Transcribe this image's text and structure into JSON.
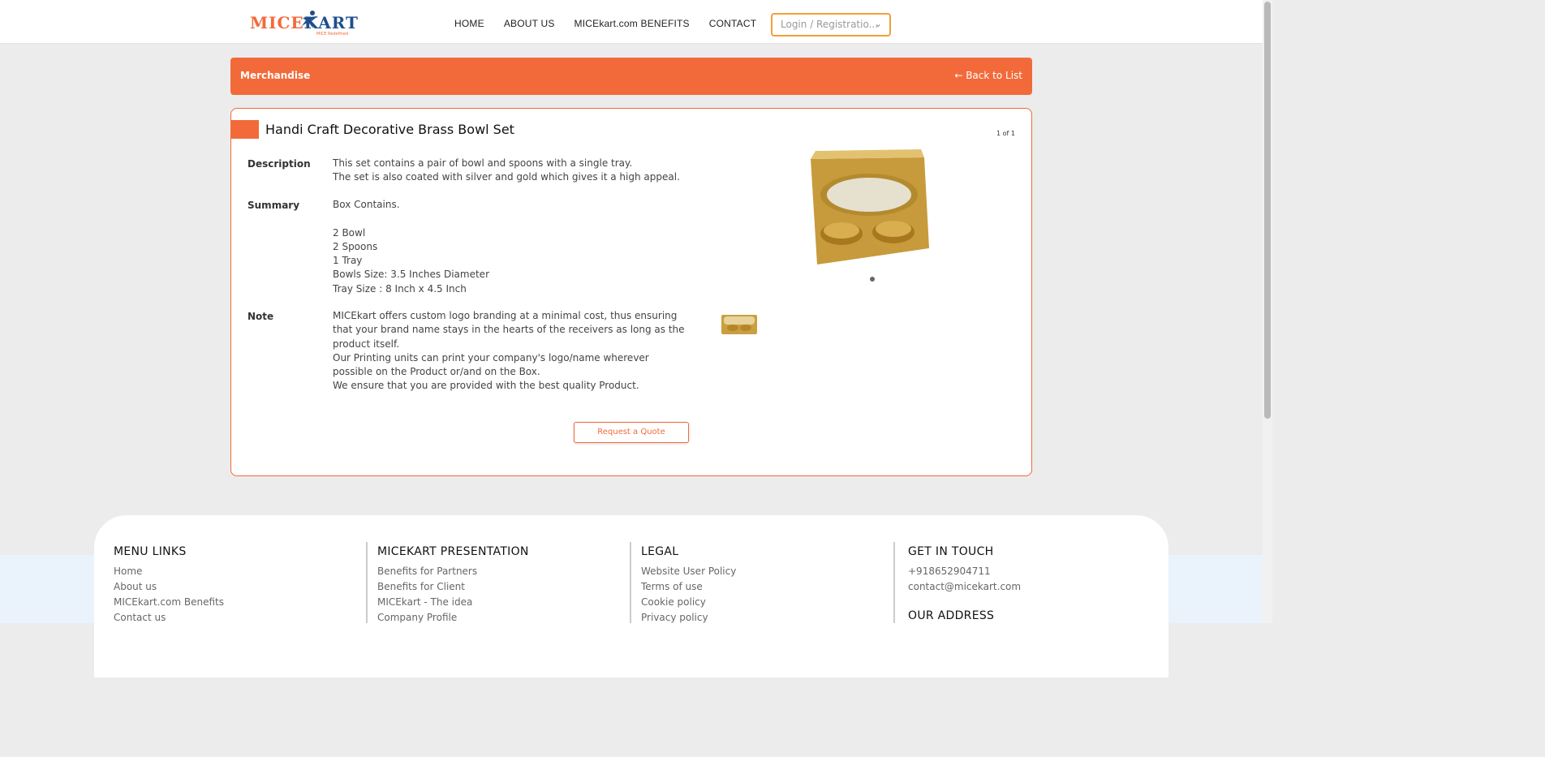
{
  "header": {
    "logo_main": "MICE",
    "logo_k": "KART",
    "logo_tag": "MICE Redefined",
    "nav": [
      "HOME",
      "ABOUT US",
      "MICEkart.com BENEFITS",
      "CONTACT"
    ],
    "login_placeholder": "Login / Registratio..."
  },
  "titlebar": {
    "category": "Merchandise",
    "back_label": "Back to List"
  },
  "product": {
    "title": "Handi Craft Decorative Brass Bowl Set",
    "counter": "1 of 1",
    "labels": {
      "description": "Description",
      "summary": "Summary",
      "note": "Note"
    },
    "description": [
      "This set contains a pair of bowl and spoons with a single tray.",
      "The set is also coated with silver and gold which gives it a high appeal."
    ],
    "summary": [
      "Box Contains.",
      "",
      "2 Bowl",
      "2 Spoons",
      "1 Tray",
      "Bowls Size: 3.5 Inches Diameter",
      "Tray Size : 8 Inch x 4.5 Inch"
    ],
    "note": [
      "MICEkart offers custom logo branding at a minimal cost, thus ensuring that your brand name stays in the hearts of the receivers as long as the product itself.",
      "Our Printing units can print your company's logo/name wherever possible on the Product or/and on the Box.",
      "We ensure that you are provided with the best quality Product."
    ],
    "quote_button": "Request a Quote"
  },
  "footer": {
    "columns": [
      {
        "title": "MENU LINKS",
        "links": [
          "Home",
          "About us",
          "MICEkart.com Benefits",
          "Contact us"
        ]
      },
      {
        "title": "MICEKART PRESENTATION",
        "links": [
          "Benefits for Partners",
          "Benefits for Client",
          "MICEkart - The idea",
          "Company Profile"
        ]
      },
      {
        "title": "LEGAL",
        "links": [
          "Website User Policy",
          "Terms of use",
          "Cookie policy",
          "Privacy policy"
        ]
      },
      {
        "title": "GET IN TOUCH",
        "links": [
          "+918652904711",
          "contact@micekart.com"
        ],
        "second_title": "OUR ADDRESS"
      }
    ]
  },
  "colors": {
    "accent": "#f26a3a",
    "logo_blue": "#1f4e8c",
    "login_border": "#f2a13a"
  }
}
